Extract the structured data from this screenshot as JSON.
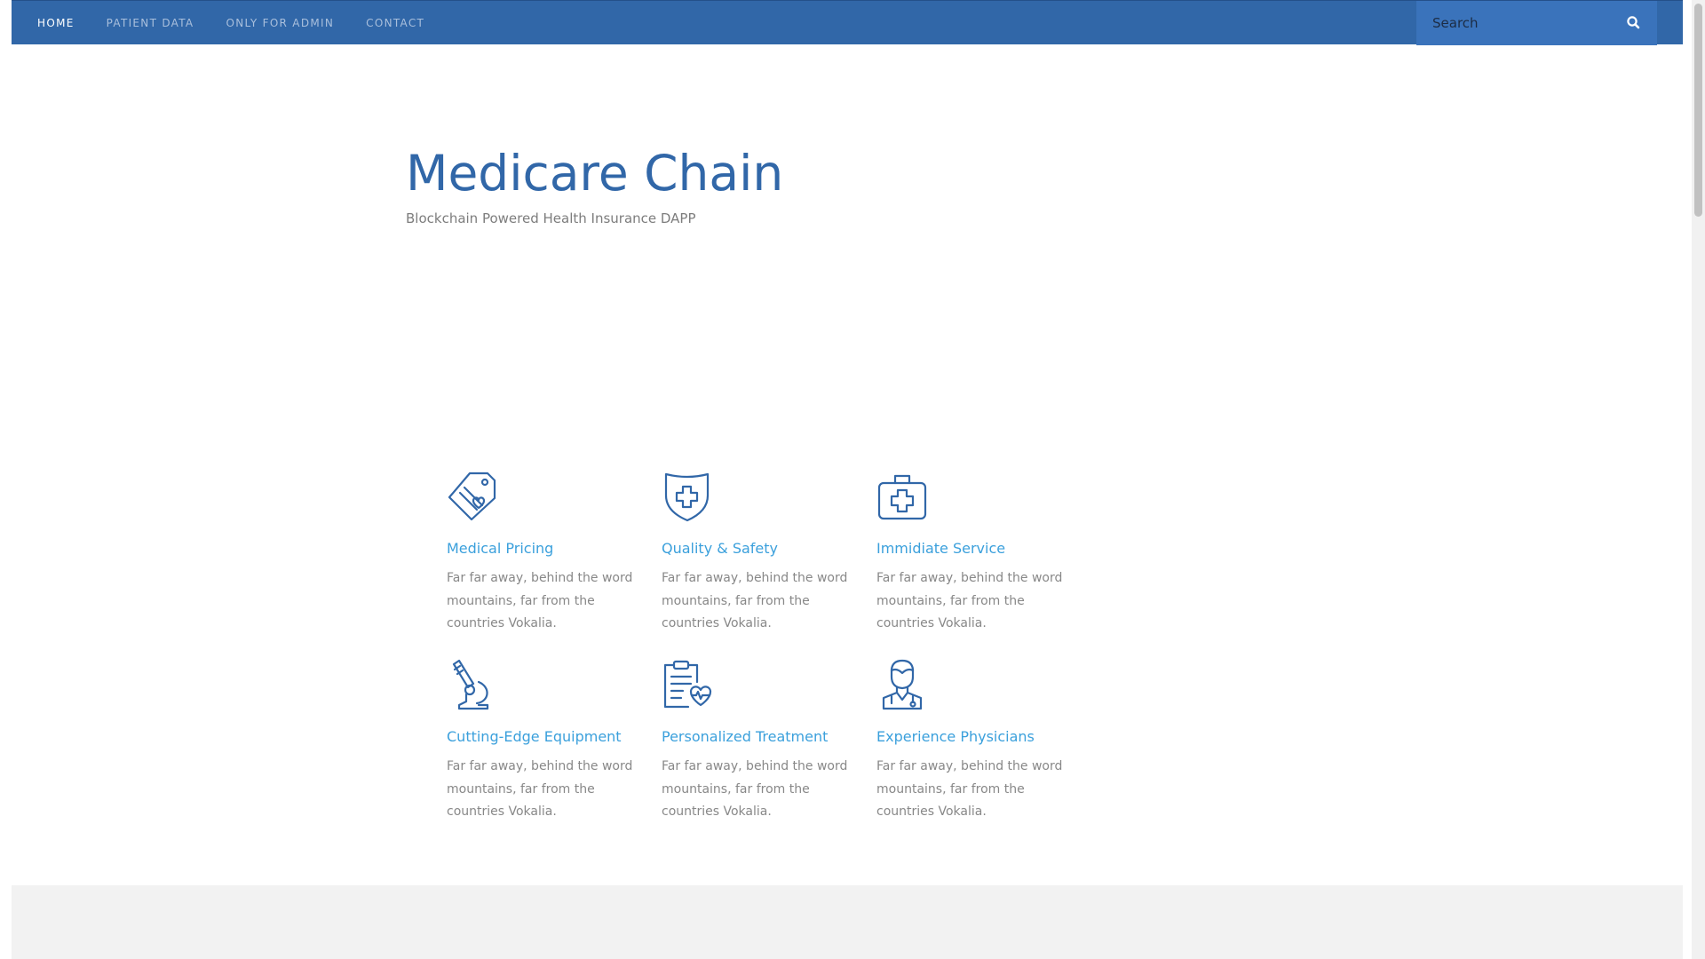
{
  "navbar": {
    "items": [
      {
        "label": "HOME",
        "active": true
      },
      {
        "label": "PATIENT DATA",
        "active": false
      },
      {
        "label": "ONLY FOR ADMIN",
        "active": false
      },
      {
        "label": "CONTACT",
        "active": false
      }
    ],
    "search": {
      "placeholder": "Search",
      "icon": "search-icon"
    }
  },
  "hero": {
    "title": "Medicare Chain",
    "subtitle": "Blockchain Powered Health Insurance DAPP"
  },
  "services": [
    {
      "icon": "price-tag-heart-icon",
      "title": "Medical Pricing",
      "text": "Far far away, behind the word mountains, far from the countries Vokalia."
    },
    {
      "icon": "shield-cross-icon",
      "title": "Quality & Safety",
      "text": "Far far away, behind the word mountains, far from the countries Vokalia."
    },
    {
      "icon": "first-aid-kit-icon",
      "title": "Immidiate Service",
      "text": "Far far away, behind the word mountains, far from the countries Vokalia."
    },
    {
      "icon": "microscope-icon",
      "title": "Cutting-Edge Equipment",
      "text": "Far far away, behind the word mountains, far from the countries Vokalia."
    },
    {
      "icon": "clipboard-heart-icon",
      "title": "Personalized Treatment",
      "text": "Far far away, behind the word mountains, far from the countries Vokalia."
    },
    {
      "icon": "doctor-icon",
      "title": "Experience Physicians",
      "text": "Far far away, behind the word mountains, far from the countries Vokalia."
    }
  ],
  "colors": {
    "navbar_bg": "#3167a8",
    "search_bg": "#3a73bb",
    "title": "#3167a8",
    "service_title": "#3ba0dc",
    "body_text": "#888888",
    "footer_band": "#f2f2f2"
  }
}
